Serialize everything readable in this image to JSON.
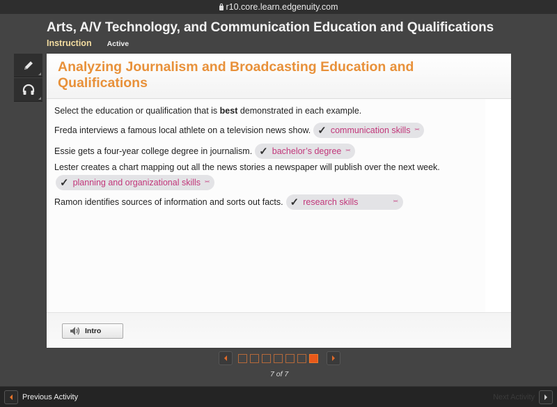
{
  "browser": {
    "url": "r10.core.learn.edgenuity.com"
  },
  "course": {
    "title": "Arts, A/V Technology, and Communication Education and Qualifications",
    "section_label": "Instruction",
    "status_label": "Active"
  },
  "tools": [
    {
      "name": "pencil",
      "icon": "pencil-icon"
    },
    {
      "name": "audio",
      "icon": "headphones-icon"
    }
  ],
  "activity": {
    "heading": "Analyzing Journalism and Broadcasting Education and Qualifications",
    "instructions_pre": "Select the education or qualification that is ",
    "instructions_bold": "best",
    "instructions_post": " demonstrated in each example.",
    "items": [
      {
        "prompt": "Freda interviews a famous local athlete on a television news show.",
        "selected": "communication skills",
        "correct": true
      },
      {
        "prompt": "Essie gets a four-year college degree in journalism.",
        "selected": "bachelor’s degree",
        "correct": true
      },
      {
        "prompt": "Lester creates a chart mapping out all the news stories a newspaper will publish over the next week.",
        "selected": "planning and organizational skills",
        "correct": true
      },
      {
        "prompt": "Ramon identifies sources of information and sorts out facts.",
        "selected": "research skills",
        "correct": true
      }
    ],
    "intro_button_label": "Intro"
  },
  "pager": {
    "current": 7,
    "total": 7,
    "label": "7 of 7"
  },
  "bottom_nav": {
    "previous_label": "Previous Activity",
    "next_label": "Next Activity",
    "next_enabled": false
  },
  "colors": {
    "heading": "#e8913a",
    "dropdown_text": "#c2377a",
    "pager_active": "#e8581a",
    "instruction_tab": "#f3dca0"
  }
}
